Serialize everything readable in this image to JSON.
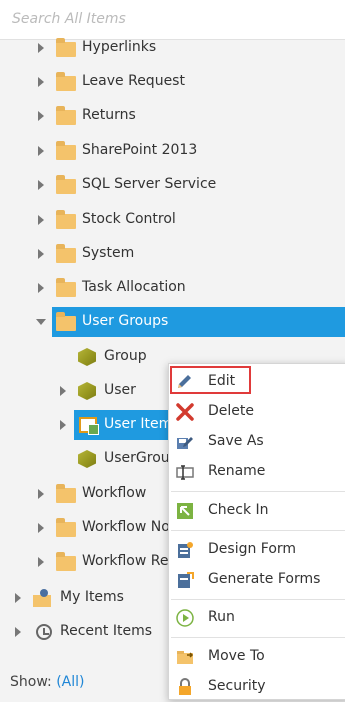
{
  "search": {
    "placeholder": "Search All Items"
  },
  "tree": {
    "folders": [
      "Hyperlinks",
      "Leave Request",
      "Returns",
      "SharePoint 2013",
      "SQL Server Service",
      "Stock Control",
      "System",
      "Task Allocation",
      "User Groups"
    ],
    "user_groups_children": [
      "Group",
      "User",
      "User Items",
      "UserGroups"
    ],
    "after_folders": [
      "Workflow",
      "Workflow Notifications",
      "Workflow Reports"
    ],
    "roots": [
      "My Items",
      "Recent Items"
    ]
  },
  "footer": {
    "show_label": "Show:",
    "show_value": "(All)"
  },
  "context_menu": {
    "items": [
      {
        "label": "Edit",
        "icon": "pencil-icon"
      },
      {
        "label": "Delete",
        "icon": "delete-x-icon"
      },
      {
        "label": "Save As",
        "icon": "save-as-icon"
      },
      {
        "label": "Rename",
        "icon": "rename-icon"
      },
      {
        "label": "Check In",
        "icon": "check-in-icon"
      },
      {
        "label": "Design Form",
        "icon": "design-form-icon"
      },
      {
        "label": "Generate Forms",
        "icon": "generate-forms-icon"
      },
      {
        "label": "Run",
        "icon": "run-icon"
      },
      {
        "label": "Move To",
        "icon": "move-to-icon"
      },
      {
        "label": "Security",
        "icon": "lock-icon"
      }
    ]
  },
  "colors": {
    "selected": "#1f9ae0",
    "folder": "#f4c36b",
    "edit_outline": "#e03a3a",
    "link": "#1f86d6"
  }
}
